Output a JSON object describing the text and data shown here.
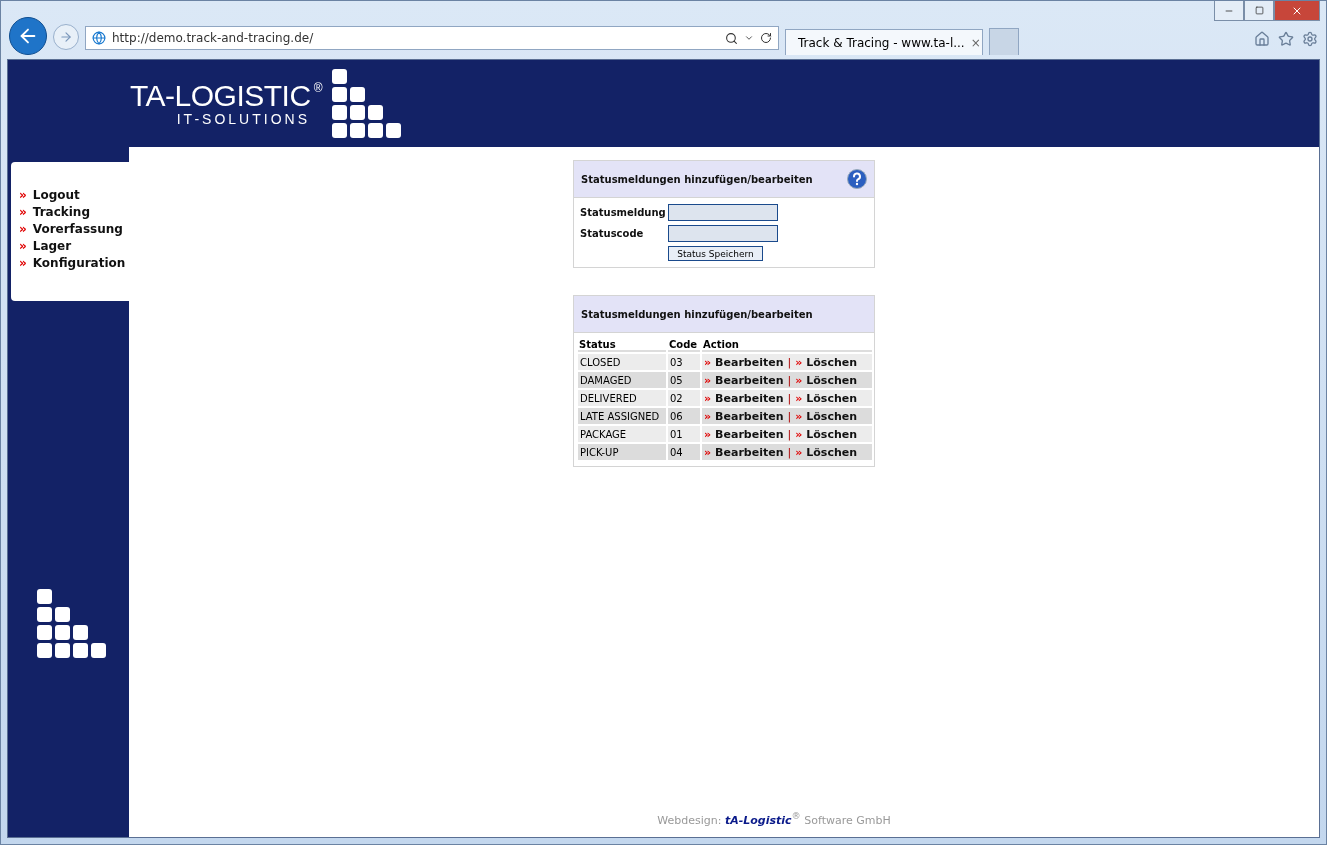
{
  "browser": {
    "address": "http://demo.track-and-tracing.de/",
    "tab_title": "Track & Tracing - www.ta-l...",
    "tab_close": "×"
  },
  "logo": {
    "name": "TA-LOGISTIC",
    "mark": "®",
    "subtitle": "IT-SOLUTIONS"
  },
  "sidebar": {
    "bullet": "»",
    "items": [
      {
        "label": "Logout"
      },
      {
        "label": "Tracking"
      },
      {
        "label": "Vorerfassung"
      },
      {
        "label": "Lager"
      },
      {
        "label": "Konfiguration"
      }
    ]
  },
  "form_panel": {
    "title": "Statusmeldungen hinzufügen/bearbeiten",
    "fields": [
      {
        "label": "Statusmeldung"
      },
      {
        "label": "Statuscode"
      }
    ],
    "button": "Status Speichern"
  },
  "list_panel": {
    "title": "Statusmeldungen hinzufügen/bearbeiten",
    "columns": [
      "Status",
      "Code",
      "Action"
    ],
    "bullet": "»",
    "separator": "|",
    "rows": [
      {
        "status": "CLOSED",
        "code": "03",
        "edit": "Bearbeiten",
        "delete": "Löschen"
      },
      {
        "status": "DAMAGED",
        "code": "05",
        "edit": "Bearbeiten",
        "delete": "Löschen"
      },
      {
        "status": "DELIVERED",
        "code": "02",
        "edit": "Bearbeiten",
        "delete": "Löschen"
      },
      {
        "status": "LATE ASSIGNED",
        "code": "06",
        "edit": "Bearbeiten",
        "delete": "Löschen"
      },
      {
        "status": "PACKAGE",
        "code": "01",
        "edit": "Bearbeiten",
        "delete": "Löschen"
      },
      {
        "status": "PICK-UP",
        "code": "04",
        "edit": "Bearbeiten",
        "delete": "Löschen"
      }
    ]
  },
  "footer": "Webdesign: **tA-Logistic**$^{®}$ Software GmbH"
}
